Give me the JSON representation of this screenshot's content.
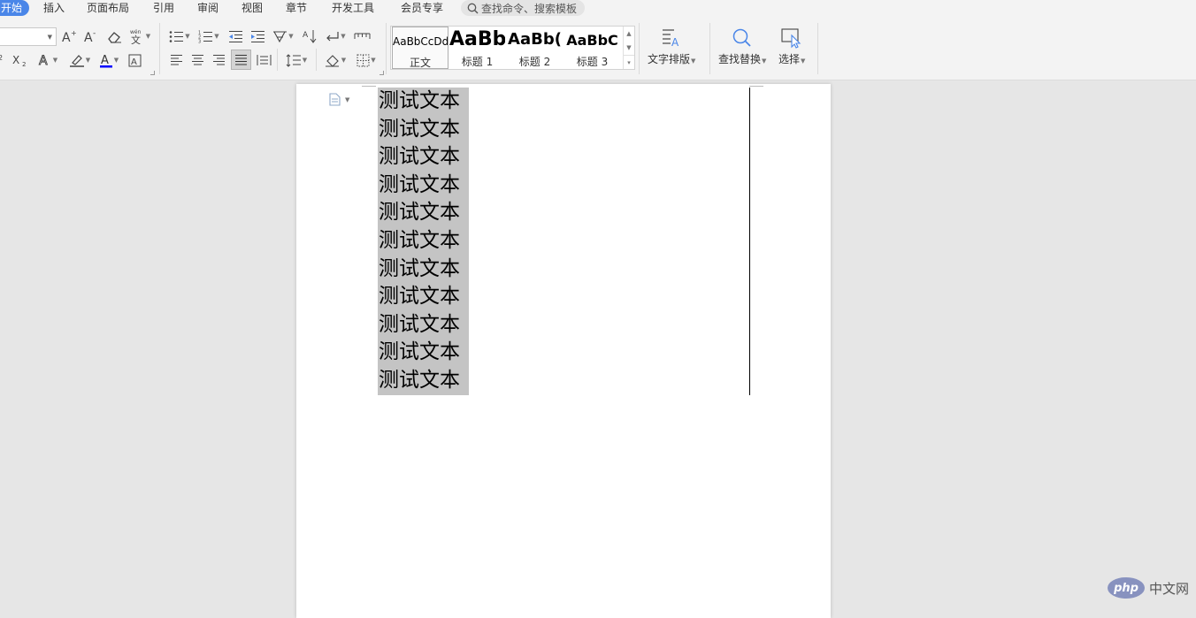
{
  "menu": {
    "tabs": [
      {
        "label": "开始",
        "active": true
      },
      {
        "label": "插入"
      },
      {
        "label": "页面布局"
      },
      {
        "label": "引用"
      },
      {
        "label": "审阅"
      },
      {
        "label": "视图"
      },
      {
        "label": "章节"
      },
      {
        "label": "开发工具"
      },
      {
        "label": "会员专享"
      }
    ],
    "search_placeholder": "查找命令、搜索模板"
  },
  "ribbon": {
    "font_size_value": "",
    "font_color": "#0000ff",
    "styles": [
      {
        "sample": "AaBbCcDd",
        "label": "正文",
        "selected": true
      },
      {
        "sample": "AaBb",
        "label": "标题 1"
      },
      {
        "sample": "AaBb(",
        "label": "标题 2"
      },
      {
        "sample": "AaBbC",
        "label": "标题 3"
      }
    ],
    "text_layout_label": "文字排版",
    "find_replace_label": "查找替换",
    "select_label": "选择"
  },
  "document": {
    "lines": [
      "测试文本",
      "测试文本",
      "测试文本",
      "测试文本",
      "测试文本",
      "测试文本",
      "测试文本",
      "测试文本",
      "测试文本",
      "测试文本",
      "测试文本"
    ],
    "selection_color": "#c4c4c4"
  },
  "watermark": {
    "logo": "php",
    "text": "中文网"
  }
}
